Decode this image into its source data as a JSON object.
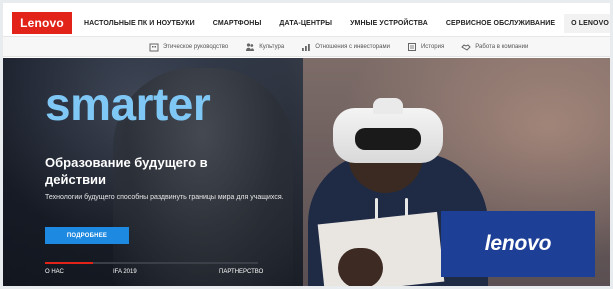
{
  "brand": {
    "logo_text": "Lenovo",
    "accent": "#e2231a",
    "blue": "#1e3f96"
  },
  "nav": {
    "items": [
      "НАСТОЛЬНЫЕ ПК И НОУТБУКИ",
      "СМАРТФОНЫ",
      "ДАТА-ЦЕНТРЫ",
      "УМНЫЕ УСТРОЙСТВА",
      "СЕРВИСНОЕ ОБСЛУЖИВАНИЕ",
      "О LENOVO"
    ]
  },
  "subnav": {
    "items": [
      {
        "label": "Этическое руководство",
        "icon": "building-icon"
      },
      {
        "label": "Культура",
        "icon": "people-icon"
      },
      {
        "label": "Отношения с инвесторами",
        "icon": "chart-icon"
      },
      {
        "label": "История",
        "icon": "book-icon"
      },
      {
        "label": "Работа в компании",
        "icon": "handshake-icon"
      }
    ]
  },
  "hero": {
    "headline": "smarter",
    "title": "Образование будущего в действии",
    "description": "Технологии будущего способны раздвинуть границы мира для учащихся.",
    "cta_label": "ПОДРОБНЕЕ",
    "badge_text": "lenovo",
    "tabs": [
      "О НАС",
      "IFA 2019",
      "ПАРТНЕРСТВО"
    ]
  }
}
